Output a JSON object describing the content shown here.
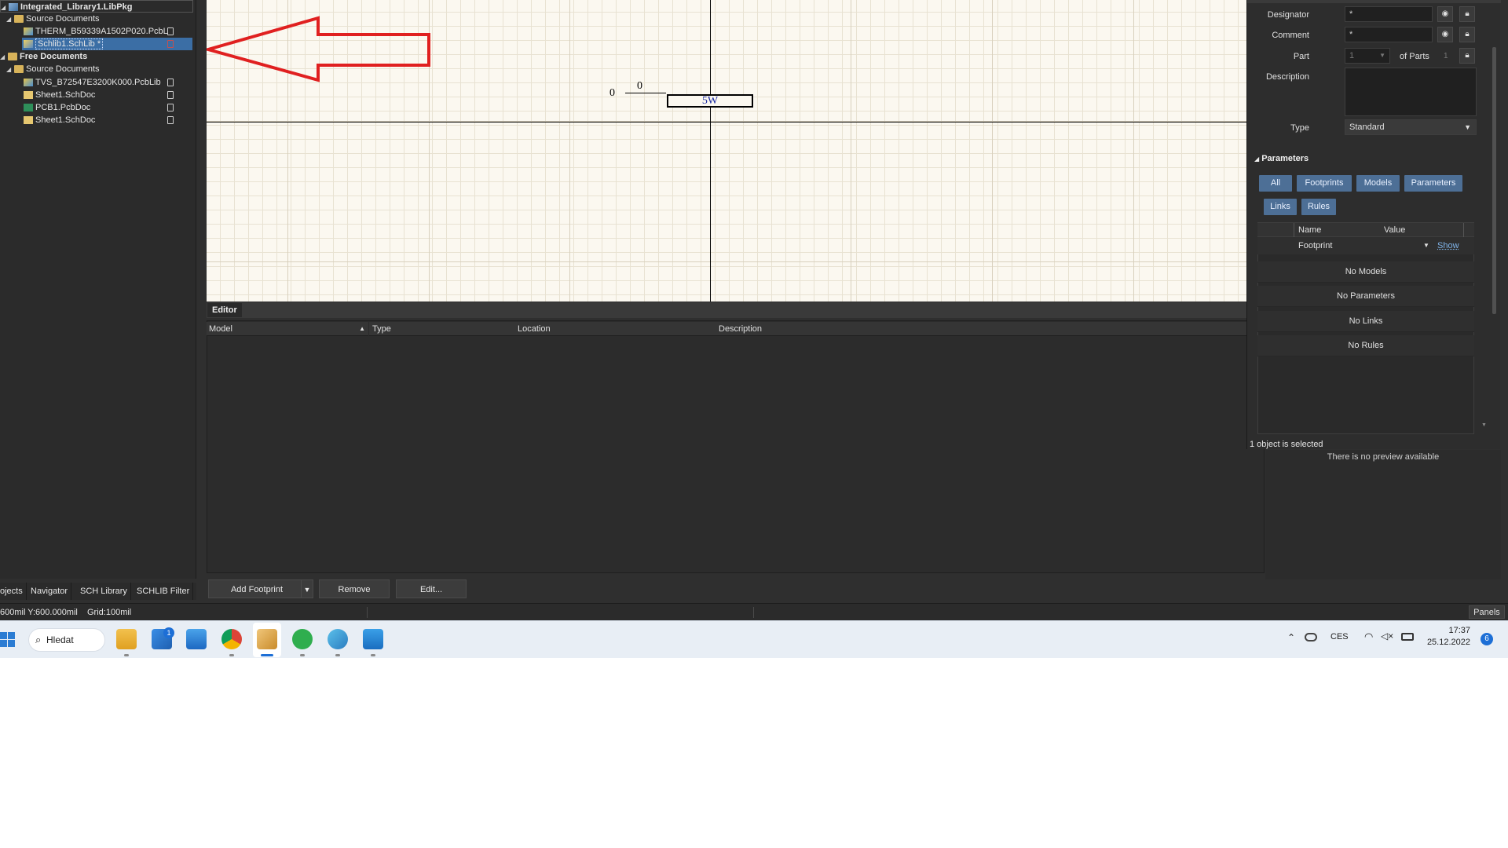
{
  "projects": {
    "root": "Integrated_Library1.LibPkg",
    "source_documents": "Source Documents",
    "therm_pcblib": "THERM_B59339A1502P020.PcbL",
    "schlib": "Schlib1.SchLib *",
    "free_documents": "Free Documents",
    "free_source_documents": "Source Documents",
    "tvs_pcblib": "TVS_B72547E3200K000.PcbLib",
    "sheet1a": "Sheet1.SchDoc",
    "pcb1": "PCB1.PcbDoc",
    "sheet1b": "Sheet1.SchDoc"
  },
  "left_tabs": [
    "ojects",
    "Navigator",
    "SCH Library",
    "SCHLIB Filter"
  ],
  "canvas": {
    "left_zero": "0",
    "top_zero": "0",
    "component_label": "5W"
  },
  "editor": {
    "tab": "Editor",
    "columns": [
      "Model",
      "Type",
      "Location",
      "Description"
    ],
    "buttons": {
      "add_footprint": "Add Footprint",
      "remove": "Remove",
      "edit": "Edit..."
    }
  },
  "properties": {
    "designator_label": "Designator",
    "designator_value": "*",
    "comment_label": "Comment",
    "comment_value": "*",
    "part_label": "Part",
    "part_value": "1",
    "of_parts_label": "of Parts",
    "of_parts_value": "1",
    "description_label": "Description",
    "type_label": "Type",
    "type_value": "Standard",
    "parameters_section": "Parameters",
    "filters": [
      "All",
      "Footprints",
      "Models",
      "Parameters",
      "Links",
      "Rules"
    ],
    "table_headers": [
      "Name",
      "Value"
    ],
    "footprint_row_name": "Footprint",
    "show_link": "Show",
    "no_models": "No Models",
    "no_parameters": "No Parameters",
    "no_links": "No Links",
    "no_rules": "No Rules",
    "selection_status": "1 object is selected",
    "no_preview": "There is no preview available"
  },
  "status_bar": {
    "coords": "600mil Y:600.000mil",
    "grid": "Grid:100mil",
    "panels": "Panels"
  },
  "taskbar": {
    "search": "Hledat",
    "store_badge": "1",
    "language": "CES",
    "time": "17:37",
    "date": "25.12.2022",
    "notifications": "6"
  },
  "colors": {
    "arrow": "#e02020",
    "chip": "#4d6f96",
    "canvas_bg": "#fbf8f0",
    "selection": "#3b6ea5"
  }
}
